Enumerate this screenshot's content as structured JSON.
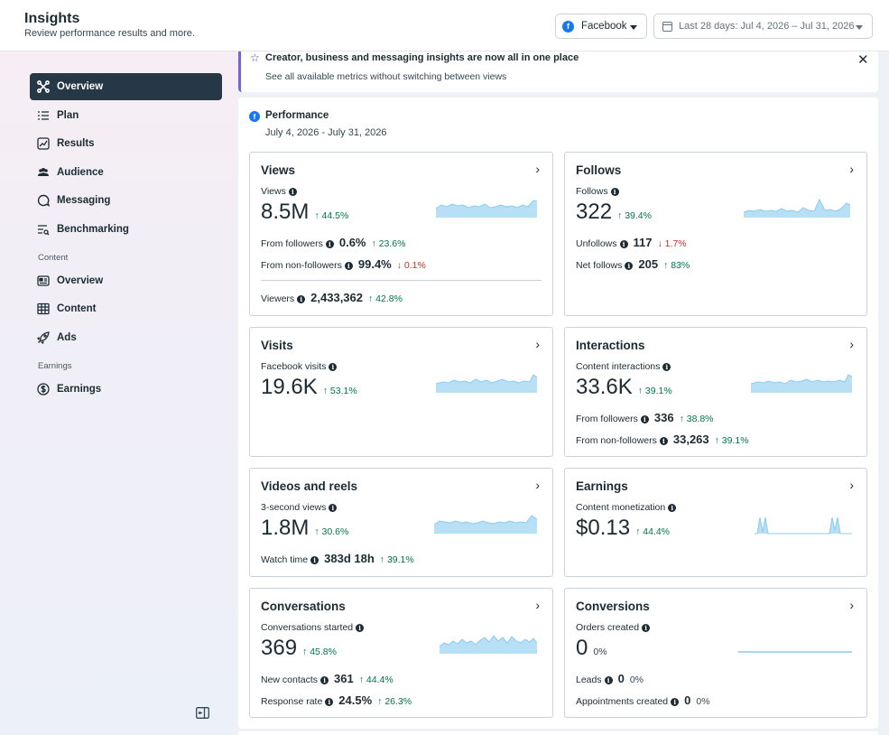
{
  "header": {
    "title": "Insights",
    "subtitle": "Review performance results and more.",
    "platform": "Facebook",
    "date_range": "Last 28 days: Jul 4, 2026 – Jul 31, 2026"
  },
  "sidebar": {
    "items": [
      {
        "label": "Overview",
        "icon": "overview-icon"
      },
      {
        "label": "Plan",
        "icon": "list-icon"
      },
      {
        "label": "Results",
        "icon": "line-chart-icon"
      },
      {
        "label": "Audience",
        "icon": "people-icon"
      },
      {
        "label": "Messaging",
        "icon": "chat-icon"
      },
      {
        "label": "Benchmarking",
        "icon": "benchmark-icon"
      }
    ],
    "content_section": "Content",
    "content_items": [
      {
        "label": "Overview",
        "icon": "content-overview-icon"
      },
      {
        "label": "Content",
        "icon": "grid-icon"
      },
      {
        "label": "Ads",
        "icon": "rocket-icon"
      }
    ],
    "earnings_section": "Earnings",
    "earnings_items": [
      {
        "label": "Earnings",
        "icon": "dollar-icon"
      }
    ]
  },
  "banner": {
    "title": "Creator, business and messaging insights are now all in one place",
    "subtitle": "See all available metrics without switching between views"
  },
  "performance": {
    "title": "Performance",
    "date": "July 4, 2026 - July 31, 2026"
  },
  "cards": {
    "views": {
      "title": "Views",
      "metric_label": "Views",
      "metric_value": "8.5M",
      "metric_change": "↑ 44.5%",
      "from_followers_label": "From followers",
      "from_followers_value": "0.6%",
      "from_followers_change": "↑ 23.6%",
      "from_non_label": "From non-followers",
      "from_non_value": "99.4%",
      "from_non_change": "↓ 0.1%",
      "viewers_label": "Viewers",
      "viewers_value": "2,433,362",
      "viewers_change": "↑ 42.8%"
    },
    "follows": {
      "title": "Follows",
      "metric_label": "Follows",
      "metric_value": "322",
      "metric_change": "↑ 39.4%",
      "unfollows_label": "Unfollows",
      "unfollows_value": "117",
      "unfollows_change": "↓ 1.7%",
      "net_label": "Net follows",
      "net_value": "205",
      "net_change": "↑ 83%"
    },
    "visits": {
      "title": "Visits",
      "metric_label": "Facebook visits",
      "metric_value": "19.6K",
      "metric_change": "↑ 53.1%"
    },
    "interactions": {
      "title": "Interactions",
      "metric_label": "Content interactions",
      "metric_value": "33.6K",
      "metric_change": "↑ 39.1%",
      "from_followers_label": "From followers",
      "from_followers_value": "336",
      "from_followers_change": "↑ 38.8%",
      "from_non_label": "From non-followers",
      "from_non_value": "33,263",
      "from_non_change": "↑ 39.1%"
    },
    "videos": {
      "title": "Videos and reels",
      "metric_label": "3-second views",
      "metric_value": "1.8M",
      "metric_change": "↑ 30.6%",
      "watch_label": "Watch time",
      "watch_value": "383d 18h",
      "watch_change": "↑ 39.1%"
    },
    "earnings": {
      "title": "Earnings",
      "metric_label": "Content monetization",
      "metric_value": "$0.13",
      "metric_change": "↑ 44.4%"
    },
    "conversations": {
      "title": "Conversations",
      "metric_label": "Conversations started",
      "metric_value": "369",
      "metric_change": "↑ 45.8%",
      "contacts_label": "New contacts",
      "contacts_value": "361",
      "contacts_change": "↑ 44.4%",
      "response_label": "Response rate",
      "response_value": "24.5%",
      "response_change": "↑ 26.3%"
    },
    "conversions": {
      "title": "Conversions",
      "metric_label": "Orders created",
      "metric_value": "0",
      "metric_change": "0%",
      "leads_label": "Leads",
      "leads_value": "0",
      "leads_change": "0%",
      "appointments_label": "Appointments created",
      "appointments_value": "0",
      "appointments_change": "0%"
    }
  },
  "colors": {
    "accent_dark": "#263846",
    "positive": "#00754a",
    "negative": "#c32d2d",
    "sparkline": "#b7dff6",
    "facebook": "#1877f2",
    "banner_accent": "#7b61d6"
  }
}
